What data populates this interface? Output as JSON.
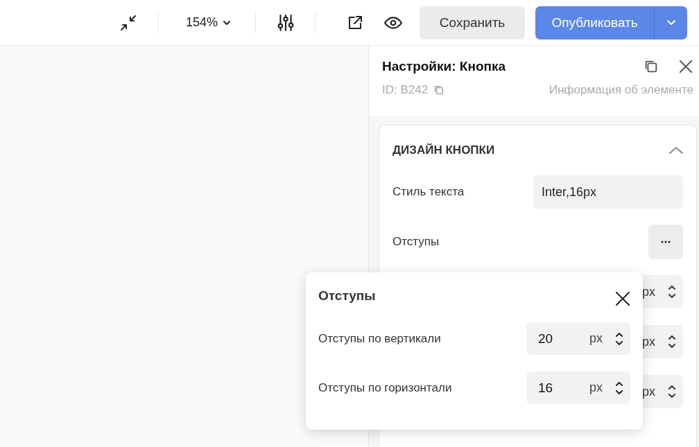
{
  "toolbar": {
    "zoom": "154%",
    "save_button": "Сохранить",
    "publish_button": "Опубликовать"
  },
  "panel": {
    "title": "Настройки: Кнопка",
    "id": "ID: B242",
    "info_link": "Информация об элементе"
  },
  "section": {
    "title": "ДИЗАЙН КНОПКИ",
    "expanded": true,
    "rows": [
      {
        "kind": "select",
        "label": "Стиль текста",
        "value": "Inter,16px"
      },
      {
        "kind": "more",
        "label": "Отступы"
      },
      {
        "kind": "number",
        "unit": "px"
      },
      {
        "kind": "number",
        "unit": "px"
      },
      {
        "kind": "number",
        "unit": "px"
      }
    ]
  },
  "popup": {
    "title": "Отступы",
    "fields": [
      {
        "label": "Отступы по вертикали",
        "value": "20",
        "unit": "px"
      },
      {
        "label": "Отступы по горизонтали",
        "value": "16",
        "unit": "px"
      }
    ]
  }
}
